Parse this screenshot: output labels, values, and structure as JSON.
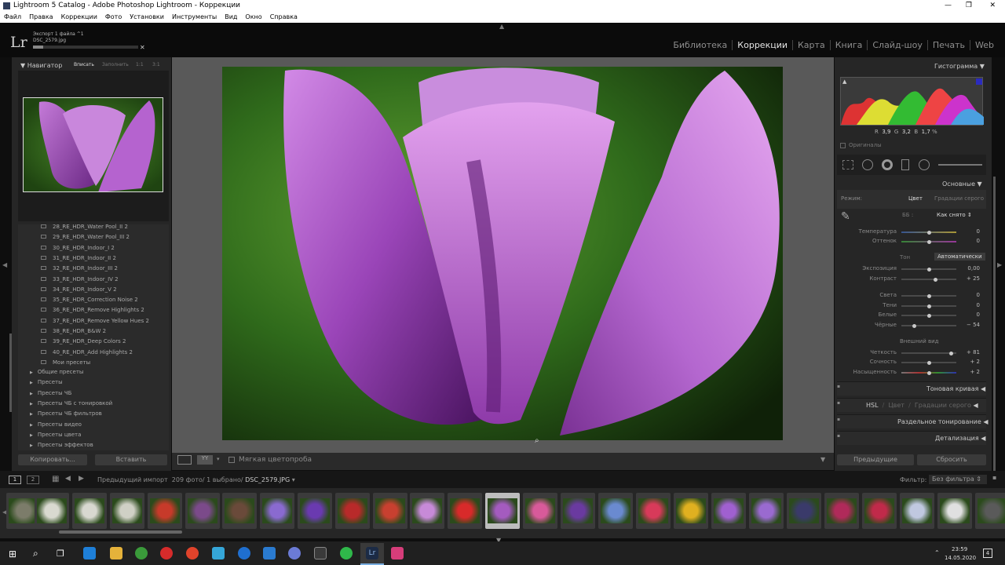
{
  "window": {
    "title": "Lightroom 5 Catalog - Adobe Photoshop Lightroom - Коррекции"
  },
  "menu": [
    "Файл",
    "Правка",
    "Коррекции",
    "Фото",
    "Установки",
    "Инструменты",
    "Вид",
    "Окно",
    "Справка"
  ],
  "header": {
    "logo": "Lr",
    "export_status": "Экспорт 1 файла ^1",
    "export_file": "DSC_2579.jpg",
    "modules": [
      "Библиотека",
      "Коррекции",
      "Карта",
      "Книга",
      "Слайд-шоу",
      "Печать",
      "Web"
    ],
    "active_module": "Коррекции"
  },
  "navigator": {
    "title": "Навигатор",
    "options": [
      "Вписать",
      "Заполнить",
      "1:1",
      "3:1"
    ]
  },
  "presets": {
    "items": [
      "28_RE_HDR_Water Pool_II 2",
      "29_RE_HDR_Water Pool_III 2",
      "30_RE_HDR_Indoor_I 2",
      "31_RE_HDR_Indoor_II 2",
      "32_RE_HDR_Indoor_III 2",
      "33_RE_HDR_Indoor_IV 2",
      "34_RE_HDR_Indoor_V 2",
      "35_RE_HDR_Correction Noise 2",
      "36_RE_HDR_Remove Highlights 2",
      "37_RE_HDR_Remove Yellow Hues 2",
      "38_RE_HDR_B&W 2",
      "39_RE_HDR_Deep Colors 2",
      "40_RE_HDR_Add Highlights 2",
      "Мои пресеты"
    ],
    "folders": [
      "Общие пресеты",
      "Пресеты",
      "Пресеты ЧБ",
      "Пресеты ЧБ с тонировкой",
      "Пресеты ЧБ фильтров",
      "Пресеты видео",
      "Пресеты цвета",
      "Пресеты эффектов"
    ],
    "copy_button": "Копировать...",
    "paste_button": "Вставить"
  },
  "toolbar": {
    "softproof": "Мягкая цветопроба"
  },
  "histogram": {
    "title": "Гистограмма",
    "r_label": "R",
    "r_value": "3,9",
    "g_label": "G",
    "g_value": "3,2",
    "b_label": "B",
    "b_value": "1,7",
    "unit": "%",
    "originals": "Оригиналы"
  },
  "basic": {
    "title": "Основные",
    "mode_label": "Режим:",
    "mode_color": "Цвет",
    "mode_gray": "Градации серого",
    "wb_label": "ББ :",
    "wb_value": "Как снято",
    "temp_label": "Температура",
    "temp_value": "0",
    "tint_label": "Оттенок",
    "tint_value": "0",
    "tone_label": "Тон",
    "auto": "Автоматически",
    "exposure_label": "Экспозиция",
    "exposure_value": "0,00",
    "contrast_label": "Контраст",
    "contrast_value": "+ 25",
    "highlights_label": "Света",
    "highlights_value": "0",
    "shadows_label": "Тени",
    "shadows_value": "0",
    "whites_label": "Белые",
    "whites_value": "0",
    "blacks_label": "Чёрные",
    "blacks_value": "− 54",
    "presence_label": "Внешний вид",
    "clarity_label": "Четкость",
    "clarity_value": "+ 81",
    "vibrance_label": "Сочность",
    "vibrance_value": "+ 2",
    "saturation_label": "Насыщенность",
    "saturation_value": "+ 2"
  },
  "sections": {
    "tone_curve": "Тоновая кривая",
    "hsl": "HSL",
    "color": "Цвет",
    "grayscale": "Градации серого",
    "split": "Раздельное тонирование",
    "detail": "Детализация"
  },
  "right_buttons": {
    "previous": "Предыдущие",
    "reset": "Сбросить"
  },
  "filmbar": {
    "page1": "1",
    "page2": "2",
    "source": "Предыдущий импорт",
    "count": "209 фото/",
    "selected": "1 выбрано/",
    "filename": "DSC_2579.JPG",
    "filter_label": "Фильтр:",
    "filter_value": "Без фильтра"
  },
  "taskbar": {
    "time": "23:59",
    "date": "14.05.2020",
    "notifications": "4"
  },
  "colors": {
    "panel": "#262626",
    "accent_purple": "#a45bbf",
    "grass": "#3e7a24"
  }
}
